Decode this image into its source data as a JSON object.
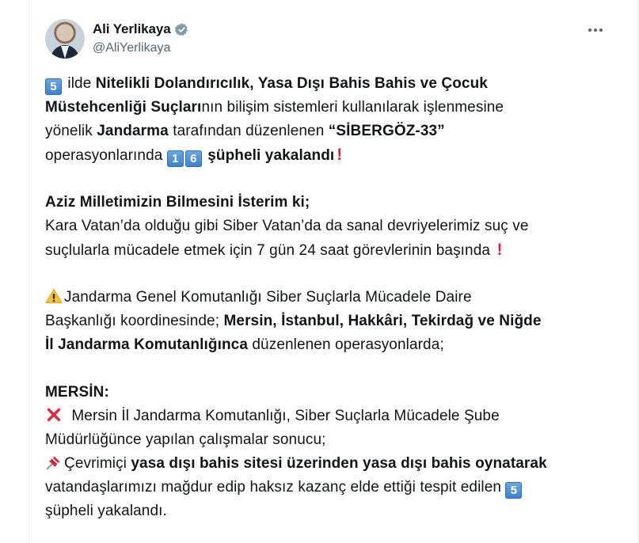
{
  "author": {
    "display_name": "Ali Yerlikaya",
    "handle": "@AliYerlikaya",
    "verified": true
  },
  "icons": {
    "avatar": "author-avatar",
    "verified": "verified-badge-icon",
    "more": "more-options-icon",
    "keycap": "keycap-digit-emoji",
    "exclamation": "red-exclamation-emoji",
    "warning": "warning-emoji",
    "cross": "cross-mark-emoji",
    "pin": "pushpin-emoji"
  },
  "colors": {
    "verified": "#829aab",
    "text": "#0f1419",
    "secondary": "#536471",
    "keycap": "#3c7fcb"
  },
  "tweet": {
    "p1": {
      "kc_5": "5",
      "t1": " ilde ",
      "b1": "Nitelikli Dolandırıcılık, Yasa Dışı Bahis Bahis ve Çocuk",
      "b2": "Müstehcenliği Suçları",
      "t2": "nın bilişim sistemleri kullanılarak işlenmesine",
      "t3": "yönelik ",
      "b3": "Jandarma",
      "t4": " tarafından düzenlenen ",
      "b4": "“SİBERGÖZ-33”",
      "t5": "operasyonlarında ",
      "kc_1": "1",
      "kc_6": "6",
      "b5": " şüpheli yakalandı",
      "excl": "!"
    },
    "p2": {
      "heading": "Aziz Milletimizin Bilmesini İsterim ki;",
      "l1": "Kara Vatan’da olduğu gibi Siber Vatan’da da sanal devriyelerimiz suç ve",
      "l2": "suçlularla mücadele etmek için 7 gün 24 saat görevlerinin başında ",
      "excl": "!"
    },
    "p3": {
      "l1": "Jandarma Genel Komutanlığı Siber Suçlarla Mücadele Daire",
      "l2": "Başkanlığı koordinesinde; ",
      "b1": "Mersin, İstanbul, Hakkâri, Tekirdağ ve Niğde",
      "b2": "İl Jandarma Komutanlığınca",
      "l3": " düzenlenen operasyonlarda;"
    },
    "p4": {
      "heading": "MERSİN:",
      "l1": " Mersin İl Jandarma Komutanlığı, Siber Suçlarla Mücadele Şube",
      "l2": "Müdürlüğünce yapılan çalışmalar sonucu;",
      "l3": "Çevrimiçi ",
      "b1": "yasa dışı bahis sitesi üzerinden yasa dışı bahis oynatarak",
      "l4": "vatandaşlarımızı mağdur edip haksız kazanç elde ettiği tespit edilen ",
      "kc_5": "5",
      "l5": "şüpheli yakalandı."
    }
  }
}
